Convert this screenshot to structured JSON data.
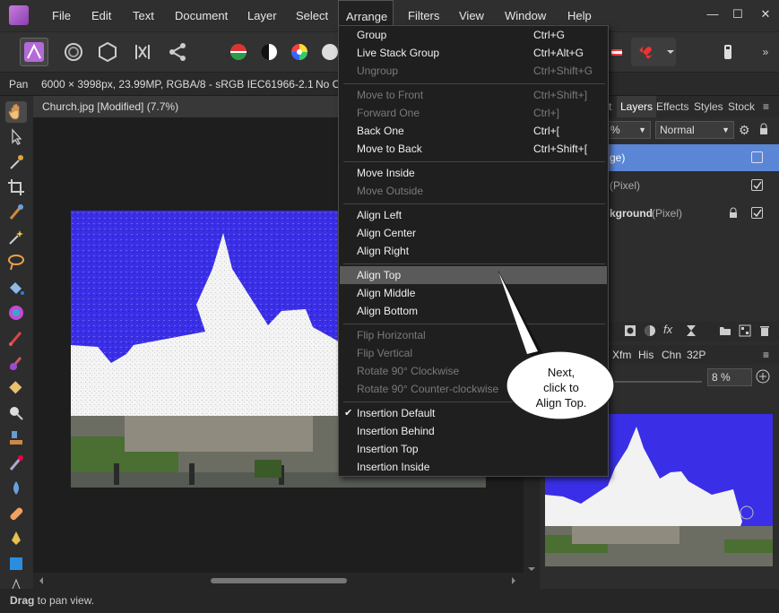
{
  "menubar": {
    "items": [
      "File",
      "Edit",
      "Text",
      "Document",
      "Layer",
      "Select",
      "Arrange",
      "Filters",
      "View",
      "Window",
      "Help"
    ],
    "active": "Arrange",
    "window_controls": [
      "—",
      "☐",
      "✕"
    ]
  },
  "context": {
    "tool": "Pan",
    "info": "6000 × 3998px, 23.99MP, RGBA/8 - sRGB IEC61966-2.1",
    "extra": "No C"
  },
  "document": {
    "tab_title": "Church.jpg [Modified] (7.7%)"
  },
  "panel": {
    "tabs": [
      "Layers",
      "Effects",
      "Styles",
      "Stock"
    ],
    "partial_tab": "t",
    "opacity_partial": "%",
    "blend_mode": "Normal",
    "layers": [
      {
        "name": "ge)",
        "kind": ""
      },
      {
        "name": "",
        "kind": "(Pixel)"
      },
      {
        "name": "kground",
        "kind": "(Pixel)"
      }
    ],
    "nav_tabs": [
      "Xfm",
      "His",
      "Chn",
      "32P"
    ],
    "zoom": "8 %",
    "fx_label": "fx"
  },
  "arrange_menu": {
    "items": [
      {
        "label": "Group",
        "shortcut": "Ctrl+G",
        "enabled": true
      },
      {
        "label": "Live Stack Group",
        "shortcut": "Ctrl+Alt+G",
        "enabled": true
      },
      {
        "label": "Ungroup",
        "shortcut": "Ctrl+Shift+G",
        "enabled": false
      },
      {
        "label": "Move to Front",
        "shortcut": "Ctrl+Shift+]",
        "enabled": false
      },
      {
        "label": "Forward One",
        "shortcut": "Ctrl+]",
        "enabled": false
      },
      {
        "label": "Back One",
        "shortcut": "Ctrl+[",
        "enabled": true
      },
      {
        "label": "Move to Back",
        "shortcut": "Ctrl+Shift+[",
        "enabled": true
      },
      {
        "label": "Move Inside",
        "shortcut": "",
        "enabled": true
      },
      {
        "label": "Move Outside",
        "shortcut": "",
        "enabled": false
      },
      {
        "label": "Align Left",
        "shortcut": "",
        "enabled": true
      },
      {
        "label": "Align Center",
        "shortcut": "",
        "enabled": true
      },
      {
        "label": "Align Right",
        "shortcut": "",
        "enabled": true
      },
      {
        "label": "Align Top",
        "shortcut": "",
        "enabled": true,
        "highlighted": true
      },
      {
        "label": "Align Middle",
        "shortcut": "",
        "enabled": true
      },
      {
        "label": "Align Bottom",
        "shortcut": "",
        "enabled": true
      },
      {
        "label": "Flip Horizontal",
        "shortcut": "",
        "enabled": false
      },
      {
        "label": "Flip Vertical",
        "shortcut": "",
        "enabled": false
      },
      {
        "label": "Rotate 90° Clockwise",
        "shortcut": "",
        "enabled": false
      },
      {
        "label": "Rotate 90° Counter-clockwise",
        "shortcut": "",
        "enabled": false
      },
      {
        "label": "Insertion Default",
        "shortcut": "",
        "enabled": true,
        "checked": true
      },
      {
        "label": "Insertion Behind",
        "shortcut": "",
        "enabled": true
      },
      {
        "label": "Insertion Top",
        "shortcut": "",
        "enabled": true
      },
      {
        "label": "Insertion Inside",
        "shortcut": "",
        "enabled": true
      }
    ]
  },
  "callout": {
    "line1": "Next,",
    "line2": "click to",
    "line3": "Align Top."
  },
  "status": {
    "bold": "Drag",
    "rest": " to pan view."
  },
  "colors": {
    "fill_blue": "#3a2fe6",
    "highlight": "#5a5a5a",
    "selected_layer": "#5b86d6"
  }
}
